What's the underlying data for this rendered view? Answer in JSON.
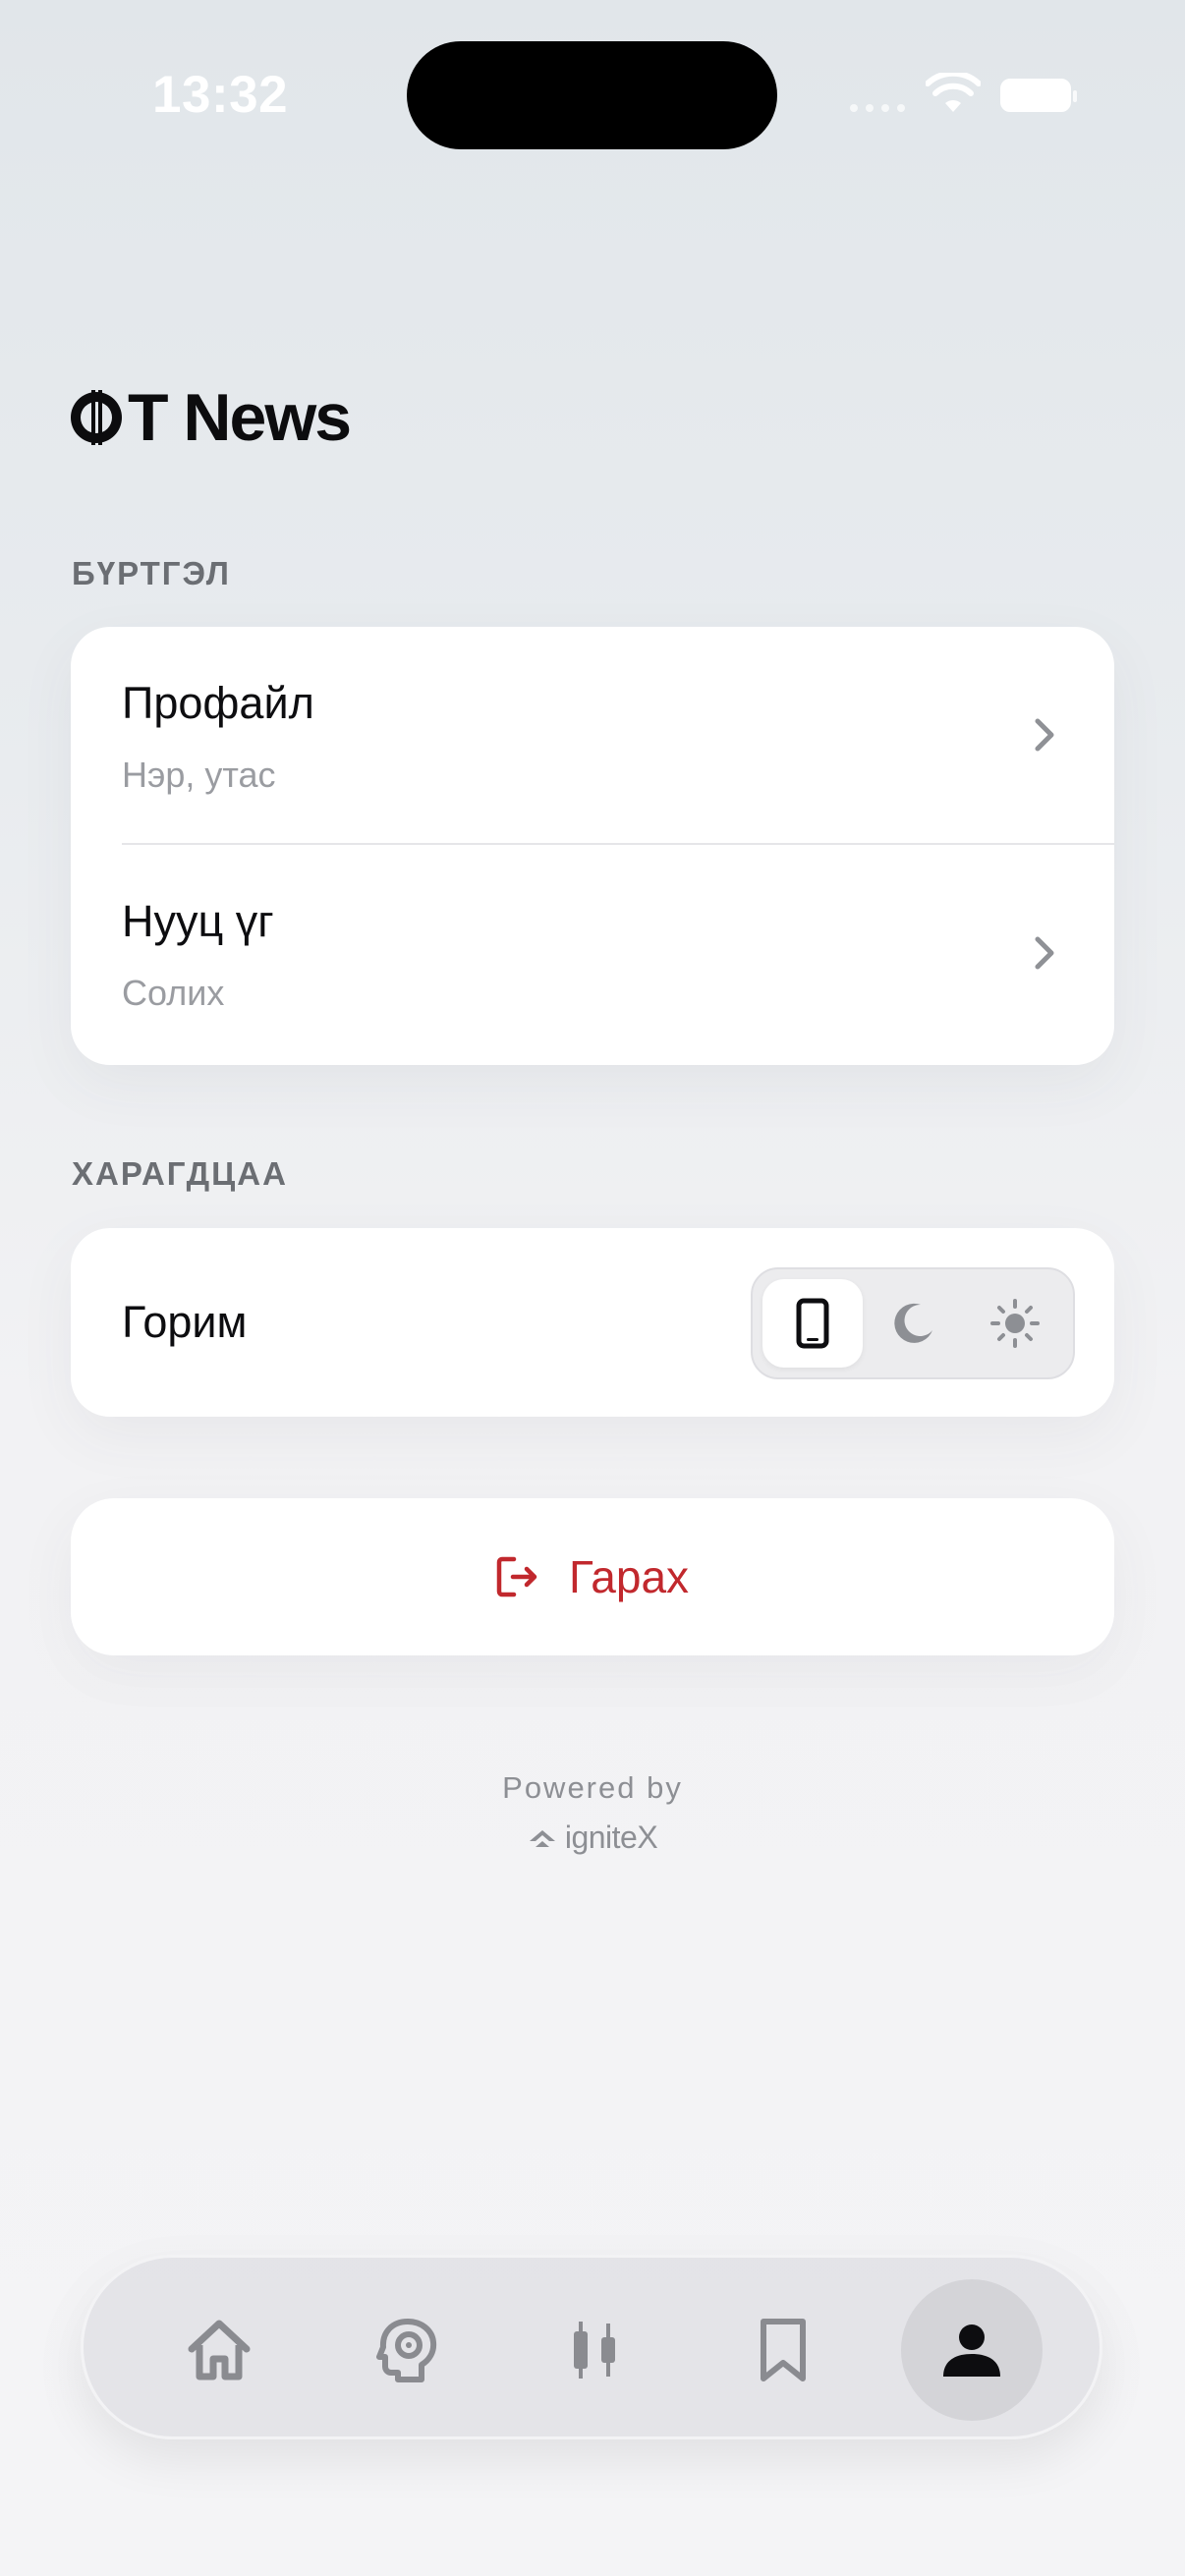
{
  "status_bar": {
    "time": "13:32"
  },
  "app": {
    "logo_text": "T News"
  },
  "sections": {
    "account_label": "БҮРТГЭЛ",
    "appearance_label": "ХАРАГДЦАА"
  },
  "account": {
    "items": [
      {
        "title": "Профайл",
        "subtitle": "Нэр, утас"
      },
      {
        "title": "Нууц үг",
        "subtitle": "Солих"
      }
    ]
  },
  "appearance": {
    "mode_label": "Горим",
    "mode_options": [
      "phone-icon",
      "moon-icon",
      "sun-icon"
    ],
    "selected_mode": "phone-icon"
  },
  "logout": {
    "label": "Гарах",
    "color": "#c1282d"
  },
  "footer": {
    "powered_by": "Powered by",
    "brand": "igniteX"
  },
  "tabbar": {
    "items": [
      "home-icon",
      "brain-gear-icon",
      "candlestick-icon",
      "bookmark-icon",
      "profile-icon"
    ],
    "active": "profile-icon"
  }
}
